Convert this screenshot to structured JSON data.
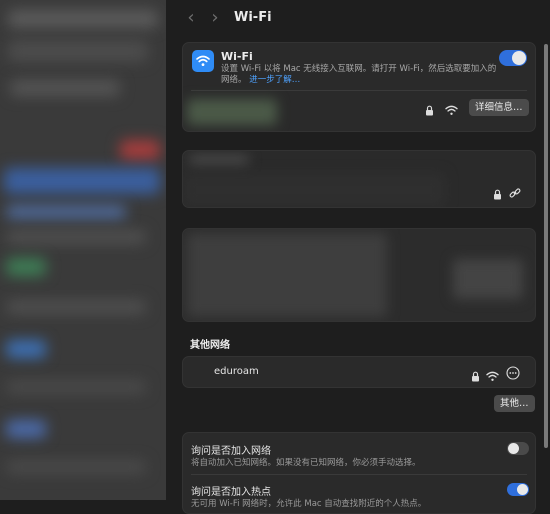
{
  "window": {
    "title": "Wi-Fi"
  },
  "wifi": {
    "name": "Wi-Fi",
    "description": "设置 Wi-Fi 以将 Mac 无线接入互联网。请打开 Wi-Fi，然后选取要加入的网络。",
    "learn_more": "进一步了解…",
    "enabled": true,
    "details_label": "详细信息…"
  },
  "other_networks": {
    "title": "其他网络",
    "items": [
      {
        "name": "eduroam"
      }
    ],
    "more_button": "其他…"
  },
  "settings": {
    "ask_join_networks": {
      "title": "询问是否加入网络",
      "desc": "将自动加入已知网络。如果没有已知网络，你必须手动选择。",
      "enabled": false
    },
    "ask_join_hotspots": {
      "title": "询问是否加入热点",
      "desc": "无可用 Wi-Fi 网络时，允许此 Mac 自动查找附近的个人热点。",
      "enabled": true
    }
  },
  "colors": {
    "accent": "#2f6fdc",
    "link": "#4fa3ff",
    "wifi_icon_bg": "#2f8cf6"
  }
}
